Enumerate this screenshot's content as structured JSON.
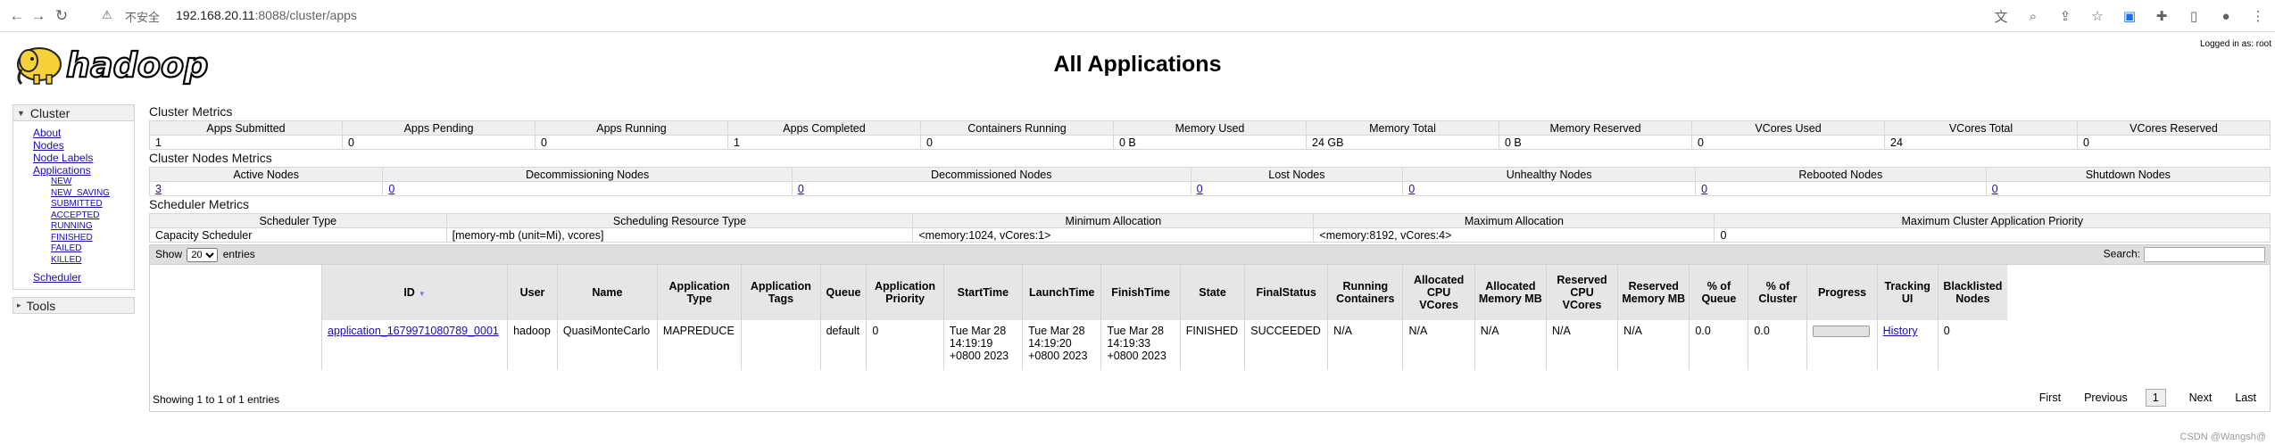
{
  "browser": {
    "back_icon": "←",
    "forward_icon": "→",
    "reload_icon": "↻",
    "warning_icon": "⚠",
    "insecure_label": "不安全",
    "url_host": "192.168.20.11",
    "url_path": ":8088/cluster/apps",
    "right_icons": [
      "translate-icon",
      "zoom-icon",
      "share-icon",
      "star-icon",
      "extension-translate-icon",
      "puzzle-icon",
      "sidebar-icon",
      "avatar-icon",
      "menu-icon"
    ]
  },
  "header": {
    "logo_text": "hadoop",
    "title": "All Applications",
    "logged_in": "Logged in as: root"
  },
  "sidebar": {
    "cluster_label": "Cluster",
    "cluster_links": [
      "About",
      "Nodes",
      "Node Labels",
      "Applications"
    ],
    "app_states": [
      "NEW",
      "NEW_SAVING",
      "SUBMITTED",
      "ACCEPTED",
      "RUNNING",
      "FINISHED",
      "FAILED",
      "KILLED"
    ],
    "scheduler_link": "Scheduler",
    "tools_label": "Tools"
  },
  "cluster_metrics": {
    "title": "Cluster Metrics",
    "headers": [
      "Apps Submitted",
      "Apps Pending",
      "Apps Running",
      "Apps Completed",
      "Containers Running",
      "Memory Used",
      "Memory Total",
      "Memory Reserved",
      "VCores Used",
      "VCores Total",
      "VCores Reserved"
    ],
    "values": [
      "1",
      "0",
      "0",
      "1",
      "0",
      "0 B",
      "24 GB",
      "0 B",
      "0",
      "24",
      "0"
    ]
  },
  "nodes_metrics": {
    "title": "Cluster Nodes Metrics",
    "headers": [
      "Active Nodes",
      "Decommissioning Nodes",
      "Decommissioned Nodes",
      "Lost Nodes",
      "Unhealthy Nodes",
      "Rebooted Nodes",
      "Shutdown Nodes"
    ],
    "values": [
      "3",
      "0",
      "0",
      "0",
      "0",
      "0",
      "0"
    ]
  },
  "scheduler_metrics": {
    "title": "Scheduler Metrics",
    "headers": [
      "Scheduler Type",
      "Scheduling Resource Type",
      "Minimum Allocation",
      "Maximum Allocation",
      "Maximum Cluster Application Priority"
    ],
    "values": [
      "Capacity Scheduler",
      "[memory-mb (unit=Mi), vcores]",
      "<memory:1024, vCores:1>",
      "<memory:8192, vCores:4>",
      "0"
    ]
  },
  "apps_table": {
    "show_label": "Show",
    "entries_value": "20",
    "entries_label": "entries",
    "search_label": "Search:",
    "columns": [
      "ID",
      "User",
      "Name",
      "Application Type",
      "Application Tags",
      "Queue",
      "Application Priority",
      "StartTime",
      "LaunchTime",
      "FinishTime",
      "State",
      "FinalStatus",
      "Running Containers",
      "Allocated CPU VCores",
      "Allocated Memory MB",
      "Reserved CPU VCores",
      "Reserved Memory MB",
      "% of Queue",
      "% of Cluster",
      "Progress",
      "Tracking UI",
      "Blacklisted Nodes"
    ],
    "rows": [
      {
        "id": "application_1679971080789_0001",
        "user": "hadoop",
        "name": "QuasiMonteCarlo",
        "type": "MAPREDUCE",
        "tags": "",
        "queue": "default",
        "priority": "0",
        "start": [
          "Tue Mar 28",
          "14:19:19",
          "+0800 2023"
        ],
        "launch": [
          "Tue Mar 28",
          "14:19:20",
          "+0800 2023"
        ],
        "finish": [
          "Tue Mar 28",
          "14:19:33",
          "+0800 2023"
        ],
        "state": "FINISHED",
        "final_status": "SUCCEEDED",
        "running_containers": "N/A",
        "alloc_vcores": "N/A",
        "alloc_mem": "N/A",
        "reserved_vcores": "N/A",
        "reserved_mem": "N/A",
        "pct_queue": "0.0",
        "pct_cluster": "0.0",
        "progress": 1.0,
        "tracking_ui": "History",
        "blacklisted": "0"
      }
    ],
    "showing_text": "Showing 1 to 1 of 1 entries",
    "pager": {
      "first": "First",
      "previous": "Previous",
      "page": "1",
      "next": "Next",
      "last": "Last"
    }
  },
  "watermark": "CSDN @Wangsh@"
}
